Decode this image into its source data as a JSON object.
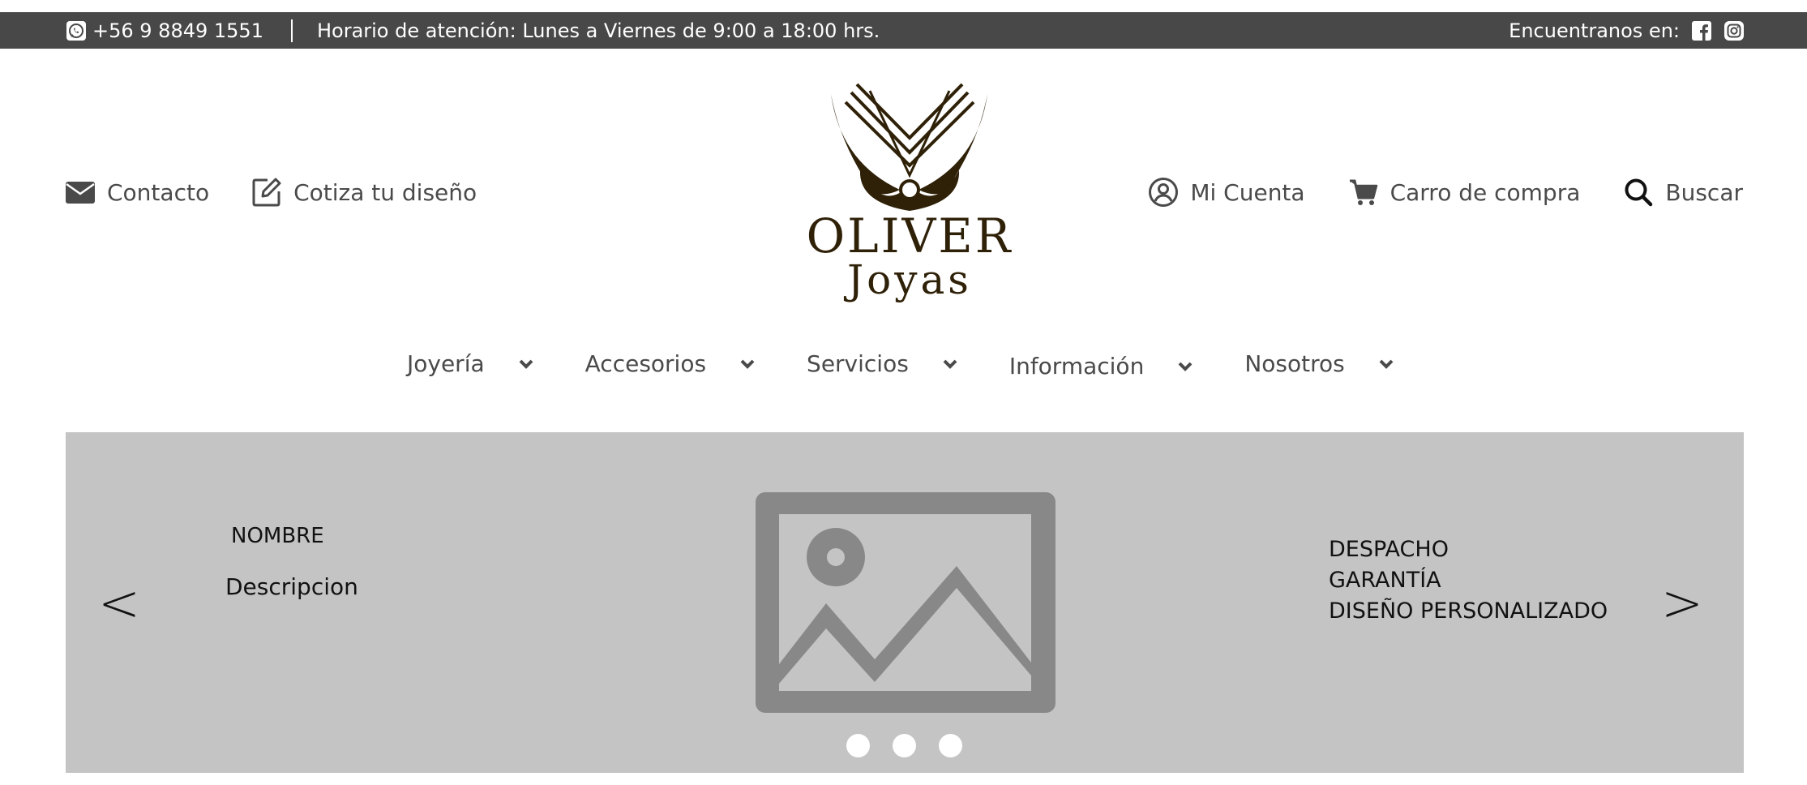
{
  "topbar": {
    "phone": "+56 9 8849 1551",
    "hours": "Horario de atención: Lunes a Viernes de 9:00 a 18:00 hrs.",
    "find_us": "Encuentranos en:",
    "icons": [
      "whatsapp-icon",
      "facebook-icon",
      "instagram-icon"
    ]
  },
  "header": {
    "left_links": [
      {
        "label": "Contacto",
        "icon": "mail-icon"
      },
      {
        "label": "Cotiza tu diseño",
        "icon": "edit-icon"
      }
    ],
    "right_links": [
      {
        "label": "Mi Cuenta",
        "icon": "user-circle-icon"
      },
      {
        "label": "Carro de compra",
        "icon": "cart-icon"
      },
      {
        "label": "Buscar",
        "icon": "search-icon"
      }
    ],
    "logo": {
      "line1": "OLIVER",
      "line2": "Joyas",
      "color": "#2f2108"
    }
  },
  "nav": {
    "items": [
      {
        "label": "Joyería"
      },
      {
        "label": "Accesorios"
      },
      {
        "label": "Servicios"
      },
      {
        "label": "Información"
      },
      {
        "label": "Nosotros"
      }
    ]
  },
  "hero": {
    "prev": "<",
    "next": ">",
    "name": "NOMBRE",
    "description": "Descripcion",
    "features": [
      "DESPACHO",
      "GARANTÍA",
      "DISEÑO PERSONALIZADO"
    ],
    "slide_count": 3,
    "background": "#c4c4c4"
  },
  "colors": {
    "topbar_bg": "#484848",
    "text": "#4a4a4a",
    "logo_brown": "#2f2108",
    "placeholder_gray": "#888888"
  }
}
